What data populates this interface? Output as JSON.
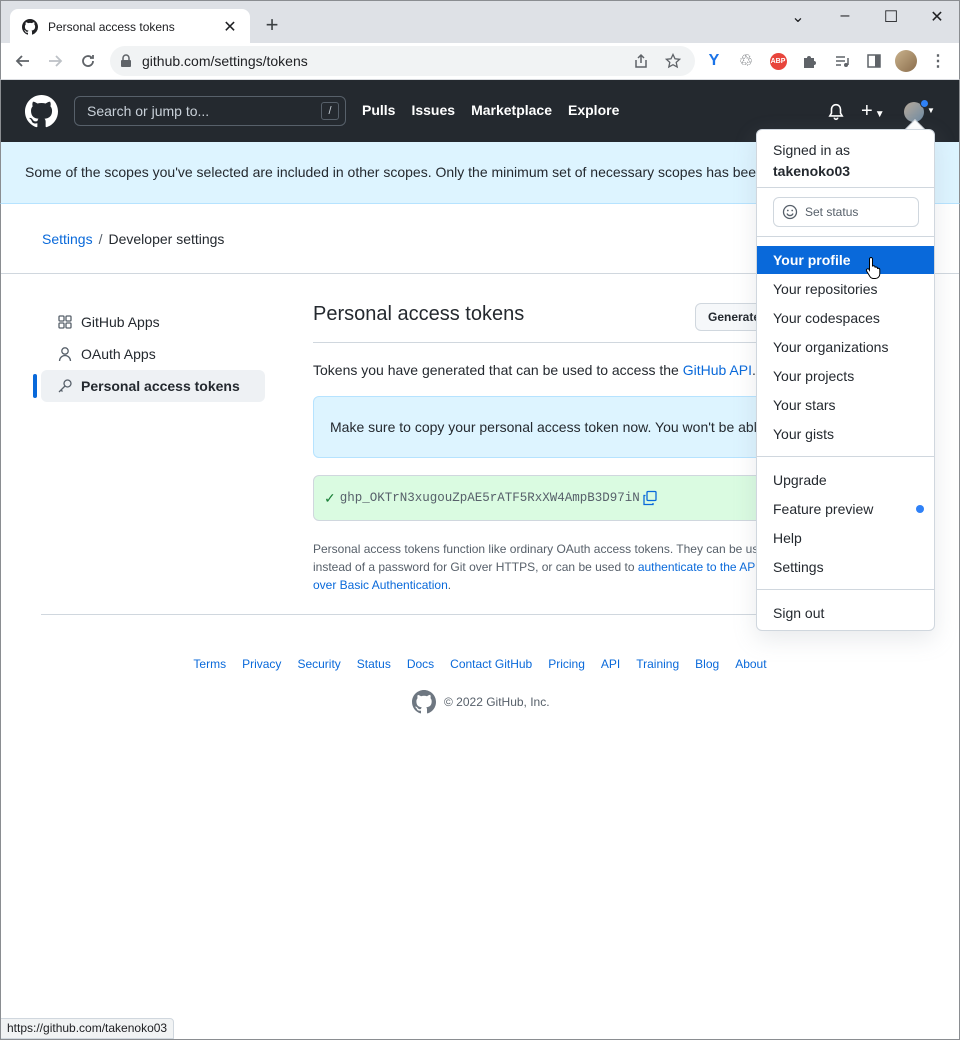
{
  "browser": {
    "tab_title": "Personal access tokens",
    "url": "github.com/settings/tokens",
    "status_url": "https://github.com/takenoko03"
  },
  "header": {
    "search_placeholder": "Search or jump to...",
    "search_key": "/",
    "nav": [
      "Pulls",
      "Issues",
      "Marketplace",
      "Explore"
    ],
    "plus": "+"
  },
  "flash": {
    "message": "Some of the scopes you've selected are included in other scopes. Only the minimum set of necessary scopes has been saved."
  },
  "breadcrumb": {
    "settings": "Settings",
    "separator": "/",
    "current": "Developer settings"
  },
  "sidenav": {
    "items": [
      {
        "label": "GitHub Apps",
        "icon": "apps-icon"
      },
      {
        "label": "OAuth Apps",
        "icon": "person-icon"
      },
      {
        "label": "Personal access tokens",
        "icon": "key-icon"
      }
    ]
  },
  "main": {
    "title": "Personal access tokens",
    "generate_label": "Generate new token",
    "desc_prefix": "Tokens you have generated that can be used to access the ",
    "desc_link": "GitHub API",
    "desc_suffix": ".",
    "notice": "Make sure to copy your personal access token now. You won't be able to see it again!",
    "token": "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",
    "note_prefix": "Personal access tokens function like ordinary OAuth access tokens. They can be used instead of a password for Git over HTTPS, or can be used to ",
    "note_link": "authenticate to the API over Basic Authentication",
    "note_suffix": "."
  },
  "footer": {
    "links": [
      "Terms",
      "Privacy",
      "Security",
      "Status",
      "Docs",
      "Contact GitHub",
      "Pricing",
      "API",
      "Training",
      "Blog",
      "About"
    ],
    "copyright": "© 2022 GitHub, Inc."
  },
  "dropdown": {
    "signed_in_as": "Signed in as",
    "username": "takenoko03",
    "set_status": "Set status",
    "items_group1": [
      "Your profile",
      "Your repositories",
      "Your codespaces",
      "Your organizations",
      "Your projects",
      "Your stars",
      "Your gists"
    ],
    "items_group2": [
      "Upgrade",
      "Feature preview",
      "Help",
      "Settings"
    ],
    "sign_out": "Sign out",
    "active_item": "Your profile"
  },
  "colors": {
    "accent": "#0969da",
    "header_bg": "#24292f",
    "flash_bg": "#ddf4ff",
    "token_bg": "#dafbe1"
  }
}
